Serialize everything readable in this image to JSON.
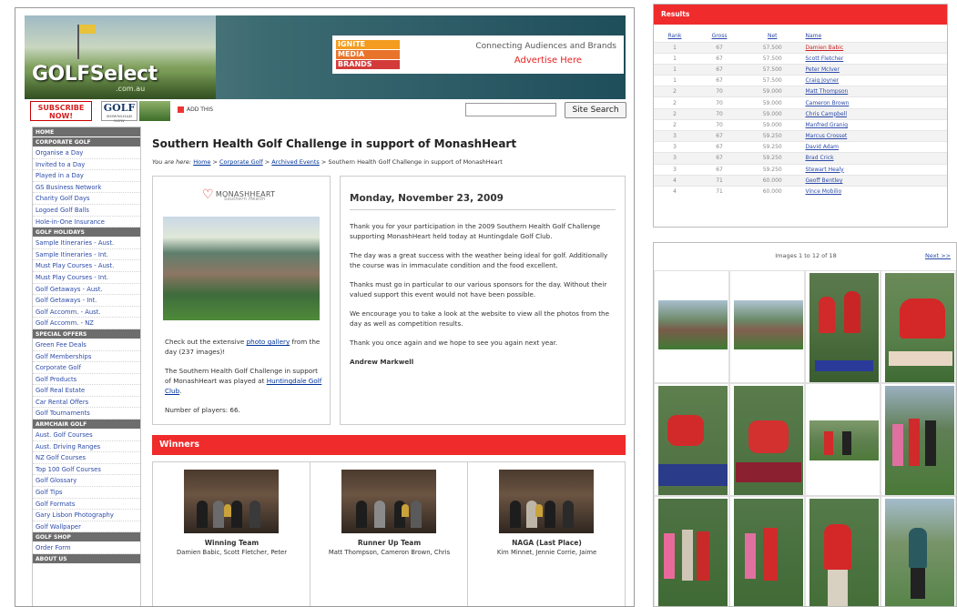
{
  "header": {
    "logo": "GOLFSelect",
    "logo_sub": ".com.au",
    "ad_lines": [
      "IGNITE",
      "MEDIA",
      "BRANDS"
    ],
    "tagline": "Connecting Audiences and Brands",
    "advertise": "Advertise Here"
  },
  "subbar": {
    "subscribe": "SUBSCRIBE NOW!",
    "golf_mag": "GOLF",
    "golf_mag_sub": "DOWNLOAD NOW",
    "addthis": "ADD THIS",
    "search_button": "Site Search"
  },
  "nav": [
    {
      "type": "head",
      "label": "HOME"
    },
    {
      "type": "head",
      "label": "CORPORATE GOLF"
    },
    {
      "type": "item",
      "label": "Organise a Day"
    },
    {
      "type": "item",
      "label": "Invited to a Day"
    },
    {
      "type": "item",
      "label": "Played in a Day"
    },
    {
      "type": "item",
      "label": "GS Business Network"
    },
    {
      "type": "item",
      "label": "Charity Golf Days"
    },
    {
      "type": "item",
      "label": "Logoed Golf Balls"
    },
    {
      "type": "item",
      "label": "Hole-in-One Insurance"
    },
    {
      "type": "head",
      "label": "GOLF HOLIDAYS"
    },
    {
      "type": "item",
      "label": "Sample Itineraries - Aust."
    },
    {
      "type": "item",
      "label": "Sample Itineraries - Int."
    },
    {
      "type": "item",
      "label": "Must Play Courses - Aust."
    },
    {
      "type": "item",
      "label": "Must Play Courses - Int."
    },
    {
      "type": "item",
      "label": "Golf Getaways - Aust."
    },
    {
      "type": "item",
      "label": "Golf Getaways - Int."
    },
    {
      "type": "item",
      "label": "Golf Accomm. - Aust."
    },
    {
      "type": "item",
      "label": "Golf Accomm. - NZ"
    },
    {
      "type": "head",
      "label": "SPECIAL OFFERS"
    },
    {
      "type": "item",
      "label": "Green Fee Deals"
    },
    {
      "type": "item",
      "label": "Golf Memberships"
    },
    {
      "type": "item",
      "label": "Corporate Golf"
    },
    {
      "type": "item",
      "label": "Golf Products"
    },
    {
      "type": "item",
      "label": "Golf Real Estate"
    },
    {
      "type": "item",
      "label": "Car Rental Offers"
    },
    {
      "type": "item",
      "label": "Golf Tournaments"
    },
    {
      "type": "head",
      "label": "ARMCHAIR GOLF"
    },
    {
      "type": "item",
      "label": "Aust. Golf Courses"
    },
    {
      "type": "item",
      "label": "Aust. Driving Ranges"
    },
    {
      "type": "item",
      "label": "NZ Golf Courses"
    },
    {
      "type": "item",
      "label": "Top 100 Golf Courses"
    },
    {
      "type": "item",
      "label": "Golf Glossary"
    },
    {
      "type": "item",
      "label": "Golf Tips"
    },
    {
      "type": "item",
      "label": "Golf Formats"
    },
    {
      "type": "item",
      "label": "Gary Lisbon Photography"
    },
    {
      "type": "item",
      "label": "Golf Wallpaper"
    },
    {
      "type": "head",
      "label": "GOLF SHOP"
    },
    {
      "type": "item",
      "label": "Order Form"
    },
    {
      "type": "head",
      "label": "ABOUT US"
    }
  ],
  "article": {
    "title": "Southern Health Golf Challenge in support of MonashHeart",
    "crumbs": {
      "prefix": "You are here:",
      "home": "Home",
      "sep": ">",
      "corporate": "Corporate Golf",
      "archived": "Archived Events",
      "current": "Southern Health Golf Challenge in support of MonashHeart"
    },
    "sponsor_logo": "MONASHHEART",
    "sponsor_sub": "Southern Health",
    "left": {
      "p1_pre": "Check out the extensive",
      "p1_link": "photo gallery",
      "p1_post": "from the day (237 images)!",
      "p2_pre": "The Southern Health Golf Challenge in support of MonashHeart was played at",
      "p2_link": "Huntingdale Golf Club",
      "p2_post": ".",
      "p3": "Number of players: 66."
    },
    "date": "Monday, November 23, 2009",
    "paragraphs": [
      "Thank you for your participation in the 2009 Southern Health Golf Challenge supporting MonashHeart held today at Huntingdale Golf Club.",
      "The day was a great success with the weather being ideal for golf. Additionally the course was in immaculate condition and the food excellent.",
      "Thanks must go in particular to our various sponsors for the day. Without their valued support this event would not have been possible.",
      "We encourage you to take a look at the website to view all the photos from the day as well as competition results.",
      "Thank you once again and we hope to see you again next year."
    ],
    "signature": "Andrew Markwell"
  },
  "winners": {
    "title": "Winners",
    "items": [
      {
        "title": "Winning Team",
        "names": "Damien Babic, Scott Fletcher, Peter"
      },
      {
        "title": "Runner Up Team",
        "names": "Matt Thompson, Cameron Brown, Chris"
      },
      {
        "title": "NAGA (Last Place)",
        "names": "Kim Minnet, Jennie Corrie, Jaime"
      }
    ]
  },
  "results": {
    "title": "Results",
    "columns": [
      "Rank",
      "Gross",
      "Net",
      "Name"
    ],
    "rows": [
      [
        "1",
        "67",
        "57.500",
        "Damien Babic"
      ],
      [
        "1",
        "67",
        "57.500",
        "Scott Fletcher"
      ],
      [
        "1",
        "67",
        "57.500",
        "Peter McIver"
      ],
      [
        "1",
        "67",
        "57.500",
        "Craig Joyner"
      ],
      [
        "2",
        "70",
        "59.000",
        "Matt Thompson"
      ],
      [
        "2",
        "70",
        "59.000",
        "Cameron Brown"
      ],
      [
        "2",
        "70",
        "59.000",
        "Chris Campbell"
      ],
      [
        "2",
        "70",
        "59.000",
        "Manfred Granig"
      ],
      [
        "3",
        "67",
        "59.250",
        "Marcus Crosset"
      ],
      [
        "3",
        "67",
        "59.250",
        "David Adam"
      ],
      [
        "3",
        "67",
        "59.250",
        "Brad Crick"
      ],
      [
        "3",
        "67",
        "59.250",
        "Stewart Healy"
      ],
      [
        "4",
        "71",
        "60.000",
        "Geoff Bentley"
      ],
      [
        "4",
        "71",
        "60.000",
        "Vince Mobilio"
      ]
    ]
  },
  "gallery": {
    "caption": "Images 1 to 12 of 18",
    "next": "Next >>"
  },
  "colors": {
    "accent_red": "#ef2b2b",
    "link_blue": "#2b4aa8",
    "nav_head": "#6d6d6d",
    "header_teal": "#1f4e5b"
  }
}
